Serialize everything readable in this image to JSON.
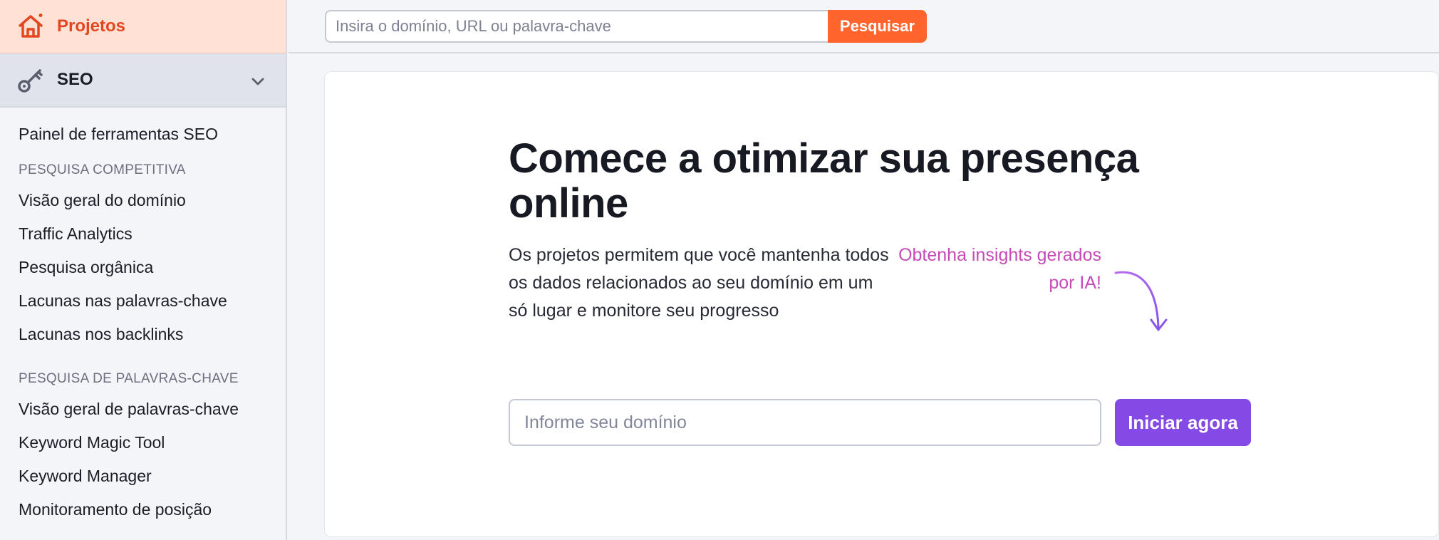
{
  "sidebar": {
    "projects": {
      "label": "Projetos",
      "icon": "home-icon"
    },
    "seo": {
      "label": "SEO",
      "icon": "key-icon"
    },
    "top_items": [
      "Painel de ferramentas SEO"
    ],
    "section1": {
      "title": "PESQUISA COMPETITIVA",
      "items": [
        "Visão geral do domínio",
        "Traffic Analytics",
        "Pesquisa orgânica",
        "Lacunas nas palavras-chave",
        "Lacunas nos backlinks"
      ]
    },
    "section2": {
      "title": "PESQUISA DE PALAVRAS-CHAVE",
      "items": [
        "Visão geral de palavras-chave",
        "Keyword Magic Tool",
        "Keyword Manager",
        "Monitoramento de posição"
      ]
    }
  },
  "topbar": {
    "search_placeholder": "Insira o domínio, URL ou palavra-chave",
    "search_button": "Pesquisar"
  },
  "main": {
    "headline": "Comece a otimizar sua presença online",
    "description": "Os projetos permitem que você mantenha todos os dados relacionados ao seu domínio em um só lugar e monitore seu progresso",
    "insight": "Obtenha insights gerados por IA!",
    "domain_placeholder": "Informe seu domínio",
    "start_button": "Iniciar agora"
  },
  "colors": {
    "accent_orange": "#ff642d",
    "projects_bg": "#ffe1d5",
    "primary_purple": "#8549e6",
    "insight_pink": "#c34cb8"
  }
}
